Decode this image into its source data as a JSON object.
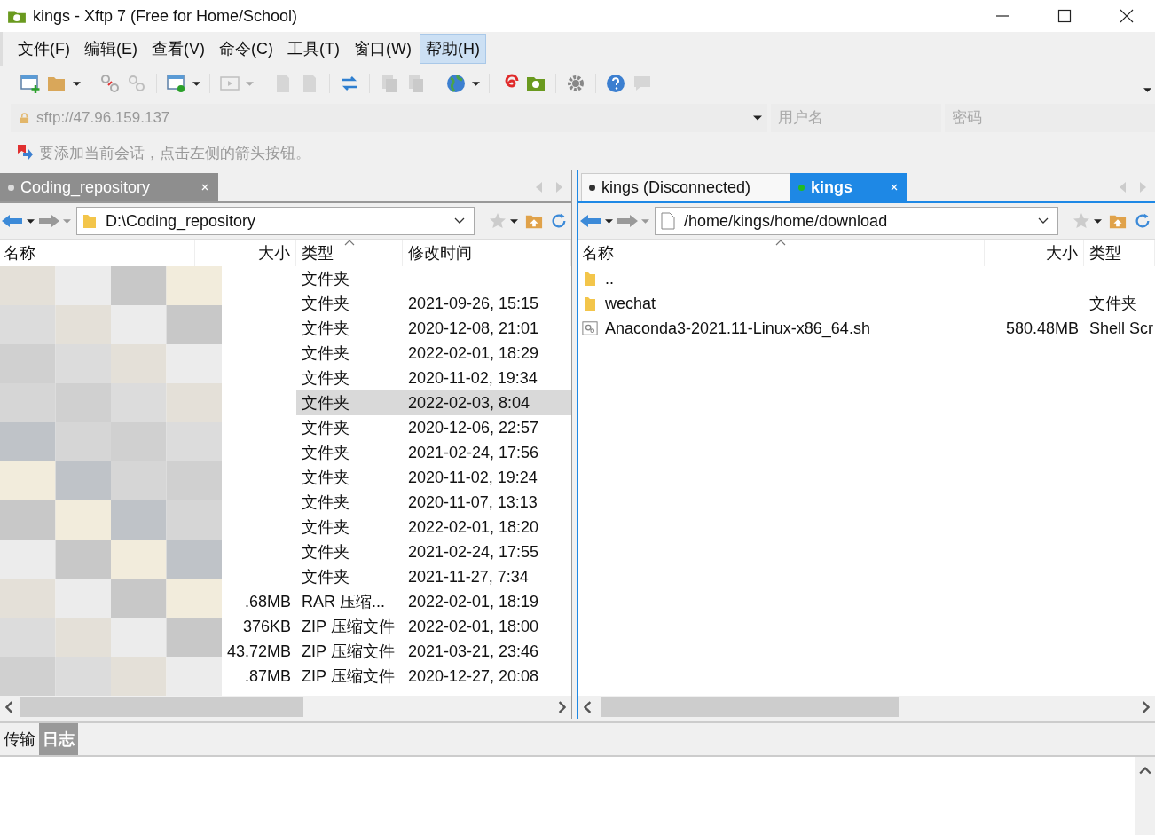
{
  "window": {
    "title": "kings - Xftp 7 (Free for Home/School)"
  },
  "menu": [
    {
      "label": "文件(F)",
      "selected": false
    },
    {
      "label": "编辑(E)",
      "selected": false
    },
    {
      "label": "查看(V)",
      "selected": false
    },
    {
      "label": "命令(C)",
      "selected": false
    },
    {
      "label": "工具(T)",
      "selected": false
    },
    {
      "label": "窗口(W)",
      "selected": false
    },
    {
      "label": "帮助(H)",
      "selected": true
    }
  ],
  "address": {
    "value": "sftp://47.96.159.137",
    "username_placeholder": "用户名",
    "password_placeholder": "密码"
  },
  "hint": "要添加当前会话，点击左侧的箭头按钮。",
  "left_pane": {
    "tabs": [
      {
        "label": "Coding_repository",
        "selected": true,
        "color": "#dddddd"
      }
    ],
    "path": "D:\\Coding_repository",
    "columns": [
      {
        "label": "名称",
        "sorted": false
      },
      {
        "label": "大小",
        "sorted": false
      },
      {
        "label": "类型",
        "sorted": true
      },
      {
        "label": "修改时间",
        "sorted": false
      }
    ],
    "rows": [
      {
        "size": "",
        "type": "文件夹",
        "modified": "",
        "selected": false
      },
      {
        "size": "",
        "type": "文件夹",
        "modified": "2021-09-26, 15:15",
        "selected": false
      },
      {
        "size": "",
        "type": "文件夹",
        "modified": "2020-12-08, 21:01",
        "selected": false
      },
      {
        "size": "",
        "type": "文件夹",
        "modified": "2022-02-01, 18:29",
        "selected": false
      },
      {
        "size": "",
        "type": "文件夹",
        "modified": "2020-11-02, 19:34",
        "selected": false
      },
      {
        "size": "",
        "type": "文件夹",
        "modified": "2022-02-03, 8:04",
        "selected": true
      },
      {
        "size": "",
        "type": "文件夹",
        "modified": "2020-12-06, 22:57",
        "selected": false
      },
      {
        "size": "",
        "type": "文件夹",
        "modified": "2021-02-24, 17:56",
        "selected": false
      },
      {
        "size": "",
        "type": "文件夹",
        "modified": "2020-11-02, 19:24",
        "selected": false
      },
      {
        "size": "",
        "type": "文件夹",
        "modified": "2020-11-07, 13:13",
        "selected": false
      },
      {
        "size": "",
        "type": "文件夹",
        "modified": "2022-02-01, 18:20",
        "selected": false
      },
      {
        "size": "",
        "type": "文件夹",
        "modified": "2021-02-24, 17:55",
        "selected": false
      },
      {
        "size": "",
        "type": "文件夹",
        "modified": "2021-11-27, 7:34",
        "selected": false
      },
      {
        "size": ".68MB",
        "type": "RAR 压缩...",
        "modified": "2022-02-01, 18:19",
        "selected": false
      },
      {
        "size": "376KB",
        "type": "ZIP 压缩文件",
        "modified": "2022-02-01, 18:00",
        "selected": false
      },
      {
        "size": "43.72MB",
        "type": "ZIP 压缩文件",
        "modified": "2021-03-21, 23:46",
        "selected": false
      },
      {
        "size": ".87MB",
        "type": "ZIP 压缩文件",
        "modified": "2020-12-27, 20:08",
        "selected": false
      }
    ]
  },
  "right_pane": {
    "tabs": [
      {
        "label": "kings (Disconnected)",
        "selected": false,
        "color": "#333333"
      },
      {
        "label": "kings",
        "selected": true,
        "color": "#22bb22"
      }
    ],
    "path": "/home/kings/home/download",
    "columns": [
      {
        "label": "名称",
        "sorted": true
      },
      {
        "label": "大小",
        "sorted": false
      },
      {
        "label": "类型",
        "sorted": false
      }
    ],
    "rows": [
      {
        "name": "..",
        "kind": "folder",
        "size": "",
        "type": ""
      },
      {
        "name": "wechat",
        "kind": "folder",
        "size": "",
        "type": "文件夹"
      },
      {
        "name": "Anaconda3-2021.11-Linux-x86_64.sh",
        "kind": "script",
        "size": "580.48MB",
        "type": "Shell Scr"
      }
    ]
  },
  "bottom_tabs": [
    {
      "label": "传输",
      "selected": false
    },
    {
      "label": "日志",
      "selected": true
    }
  ]
}
